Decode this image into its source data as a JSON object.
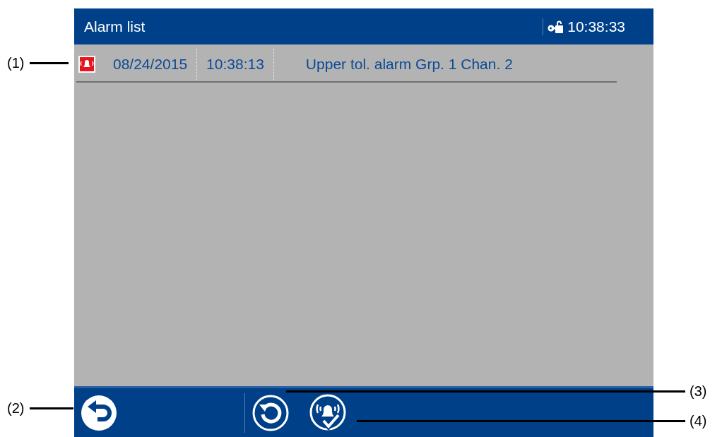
{
  "header": {
    "title": "Alarm list",
    "time": "10:38:33"
  },
  "alarms": [
    {
      "date": "08/24/2015",
      "time": "10:38:13",
      "message": "Upper tol. alarm Grp. 1 Chan. 2"
    }
  ],
  "callouts": [
    {
      "label": "(1)"
    },
    {
      "label": "(2)"
    },
    {
      "label": "(3)"
    },
    {
      "label": "(4)"
    }
  ]
}
